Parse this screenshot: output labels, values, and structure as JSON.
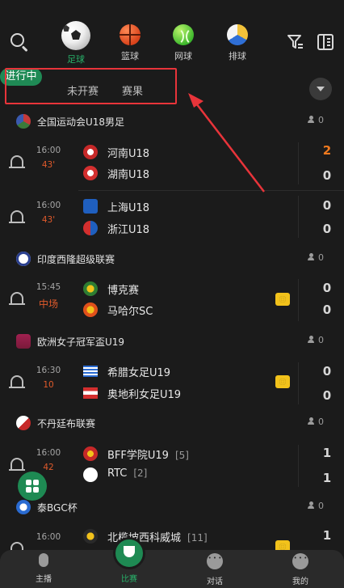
{
  "sports": [
    {
      "label": "足球",
      "active": true,
      "icon": "soccer-ball-icon"
    },
    {
      "label": "篮球",
      "active": false,
      "icon": "basketball-icon"
    },
    {
      "label": "网球",
      "active": false,
      "icon": "tennis-ball-icon"
    },
    {
      "label": "排球",
      "active": false,
      "icon": "volleyball-icon"
    }
  ],
  "status_tabs": {
    "live": "进行中",
    "upcoming": "未开赛",
    "results": "赛果"
  },
  "colors": {
    "accent": "#1f8a55",
    "live_minute": "#e05a2b",
    "leading_score": "#ef7a1f",
    "annotation": "#e8343a",
    "highlight_icon": "#f2c21b"
  },
  "leagues": [
    {
      "name": "全国运动会U18男足",
      "viewers": "0"
    },
    {
      "name": "印度西隆超级联赛",
      "viewers": "0"
    },
    {
      "name": "欧洲女子冠军盃U19",
      "viewers": "0"
    },
    {
      "name": "不丹廷布联赛",
      "viewers": "0"
    },
    {
      "name": "泰BGC杯",
      "viewers": "0"
    }
  ],
  "matches": [
    {
      "time": "16:00",
      "minute": "43'",
      "home": "河南U18",
      "away": "湖南U18",
      "home_rank": "",
      "away_rank": "",
      "home_score": "2",
      "away_score": "0",
      "home_leading": true
    },
    {
      "time": "16:00",
      "minute": "43'",
      "home": "上海U18",
      "away": "浙江U18",
      "home_rank": "",
      "away_rank": "",
      "home_score": "0",
      "away_score": "0"
    },
    {
      "time": "15:45",
      "minute": "中场",
      "home": "博克赛",
      "away": "马哈尔SC",
      "home_rank": "",
      "away_rank": "",
      "home_score": "0",
      "away_score": "0",
      "highlight": true
    },
    {
      "time": "16:30",
      "minute": "10",
      "home": "希腊女足U19",
      "away": "奥地利女足U19",
      "home_rank": "",
      "away_rank": "",
      "home_score": "0",
      "away_score": "0",
      "highlight": true
    },
    {
      "time": "16:00",
      "minute": "42",
      "home": "BFF学院U19",
      "away": "RTC",
      "home_rank": "[5]",
      "away_rank": "[2]",
      "home_score": "1",
      "away_score": "1"
    },
    {
      "time": "16:00",
      "minute": "",
      "home": "北榄坡西科威城",
      "away": "",
      "home_rank": "[11]",
      "away_rank": "",
      "home_score": "1",
      "away_score": "",
      "highlight": true
    }
  ],
  "bottom_nav": [
    {
      "label": "主播",
      "icon": "microphone-icon"
    },
    {
      "label": "比赛",
      "icon": "trophy-icon",
      "active": true
    },
    {
      "label": "对话",
      "icon": "chat-icon"
    },
    {
      "label": "我的",
      "icon": "profile-icon"
    }
  ]
}
